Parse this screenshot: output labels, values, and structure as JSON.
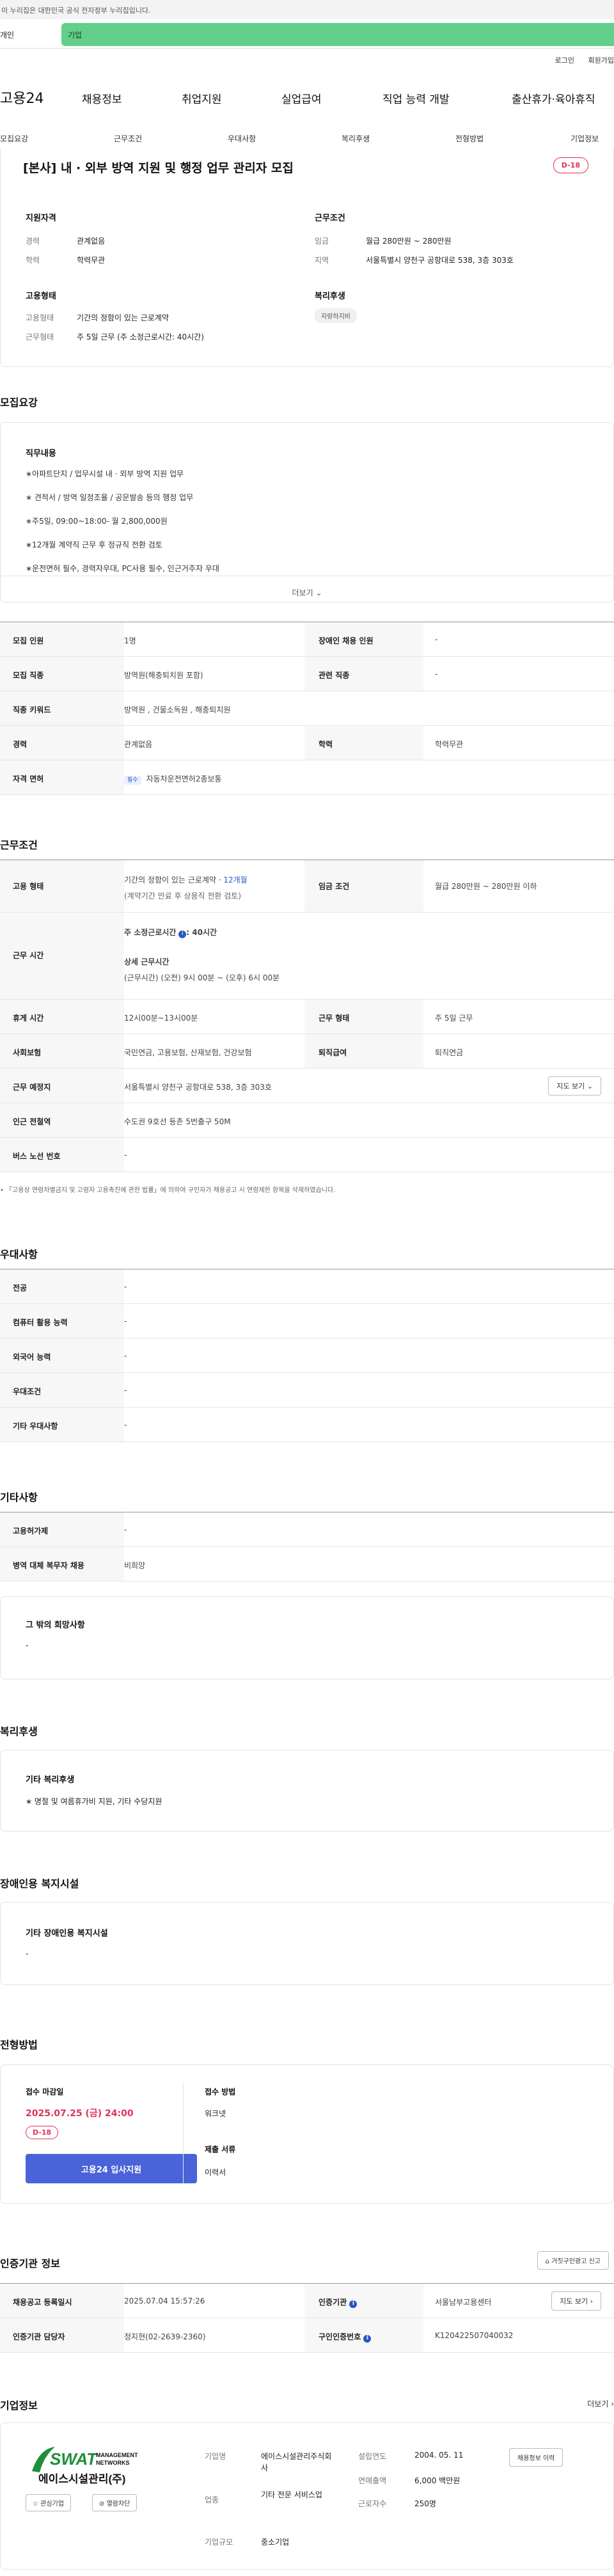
{
  "gov_banner": "이 누리집은 대한민국 공식 전자정부 누리집입니다.",
  "top_tabs": {
    "person": "개인",
    "corp": "기업"
  },
  "util": {
    "login": "로그인",
    "signup": "회원가입"
  },
  "gnb": {
    "logo": "고용24",
    "menus": [
      "채용정보",
      "취업지원",
      "실업급여",
      "직업 능력 개발",
      "출산휴가·육아휴직"
    ]
  },
  "lnb": [
    "모집요강",
    "근무조건",
    "우대사항",
    "복리후생",
    "전형방법",
    "기업정보"
  ],
  "header": {
    "title": "[본사] 내 · 외부 방역 지원 및 행정 업무 관리자 모집",
    "dday": "D-18",
    "qual_label": "지원자격",
    "career_k": "경력",
    "career_v": "관계없음",
    "edu_k": "학력",
    "edu_v": "학력무관",
    "cond_label": "근무조건",
    "wage_k": "임금",
    "wage_v": "월급 280만원 ~ 280만원",
    "area_k": "지역",
    "area_v": "서울특별시 양천구 공항대로 538, 3층 303호",
    "emp_label": "고용형태",
    "emptype_k": "고용형태",
    "emptype_v": "기간의 정함이 있는 근로계약",
    "worktype_k": "근무형태",
    "worktype_v": "주 5일 근무 (주 소정근로시간: 40시간)",
    "welfare_label": "복리후생",
    "welfare_chip": "자랑하지비"
  },
  "recruit": {
    "heading": "모집요강",
    "duty_label": "직무내용",
    "duties": [
      "∗아파트단지 / 업무시설 내 · 외부 방역 지원 업무",
      "∗ 견적서 / 방역 일정조율 / 공문발송 등의 행정 업무",
      "∗주5일, 09:00~18:00- 월 2,800,000원",
      "∗12개월 계약직 근무 후 정규직 전환 검토",
      "∗운전면허 필수, 경력자우대, PC사용 필수, 인근거주자 우대"
    ],
    "more": "더보기"
  },
  "recruit_table": {
    "headcount_k": "모집 인원",
    "headcount_v": "1명",
    "disabled_k": "장애인 채용 인원",
    "disabled_v": "-",
    "job_k": "모집 직종",
    "job_v": "방역원(해충퇴치원 포함)",
    "related_k": "관련 직종",
    "related_v": "-",
    "keyword_k": "직종 키워드",
    "keyword_v": "방역원 , 건물소독원 , 해충퇴치원",
    "career_k": "경력",
    "career_v": "관계없음",
    "edu_k": "학력",
    "edu_v": "학력무관",
    "license_k": "자격 면허",
    "license_tag": "필수",
    "license_v": "자동차운전면허2종보통"
  },
  "work": {
    "heading": "근무조건",
    "emptype_k": "고용 형태",
    "emptype_v1": "기간의 정함이 있는 근로계약 · ",
    "emptype_months": "12개월",
    "emptype_v2": "(계약기간 만료 후 상용직 전환 검토)",
    "wage_k": "임금 조건",
    "wage_v": "월급 280만원 ~ 280만원 이하",
    "hours_k": "근무 시간",
    "hours_weekly_label": "주 소정근로시간",
    "hours_weekly_v": ": 40시간",
    "hours_detail_label": "상세 근무시간",
    "hours_detail_v": "(근무시간) (오전) 9시 00분 ~ (오후) 6시 00분",
    "break_k": "휴게 시간",
    "break_v": "12시00분~13시00분",
    "form_k": "근무 형태",
    "form_v": "주 5일 근무",
    "ins_k": "사회보험",
    "ins_v": "국민연금, 고용보험, 산재보험, 건강보험",
    "retire_k": "퇴직급여",
    "retire_v": "퇴직연금",
    "place_k": "근무 예정지",
    "place_v": "서울특별시 양천구 공항대로 538, 3층 303호",
    "map_btn": "지도 보기",
    "subway_k": "인근 전철역",
    "subway_v": "수도권 9호선 등촌 5번출구 50M",
    "bus_k": "버스 노선 번호",
    "bus_v": "-",
    "note": "「고용상 연령차별금지 및 고령자 고용촉진에 관한 법률」에 의하여 구인자가 채용공고 시 연령제한 항목을 삭제하였습니다."
  },
  "pref": {
    "heading": "우대사항",
    "rows": [
      {
        "k": "전공",
        "v": "-"
      },
      {
        "k": "컴퓨터 활용 능력",
        "v": "-"
      },
      {
        "k": "외국어 능력",
        "v": "-"
      },
      {
        "k": "우대조건",
        "v": "-"
      },
      {
        "k": "기타 우대사항",
        "v": "-"
      }
    ]
  },
  "etc": {
    "heading": "기타사항",
    "rows": [
      {
        "k": "고용허가제",
        "v": "-"
      },
      {
        "k": "병역 대체 복무자 채용",
        "v": "비희망"
      }
    ],
    "hope_label": "그 밖의 희망사항",
    "hope_v": "-"
  },
  "welfare": {
    "heading": "복리후생",
    "label": "기타 복리후생",
    "v": "∗ 명절 및 여름휴가비 지원, 기타 수당지원"
  },
  "disability": {
    "heading": "장애인용 복지시설",
    "label": "기타 장애인용 복지시설",
    "v": "-"
  },
  "screening": {
    "heading": "전형방법",
    "deadline_label": "접수 마감일",
    "deadline_v": "2025.07.25 (금) 24:00",
    "dday": "D-18",
    "apply_btn": "고용24 입사지원",
    "method_label": "접수 방법",
    "method_v": "워크넷",
    "docs_label": "제출 서류",
    "docs_v": "이력서"
  },
  "agency": {
    "heading": "인증기관 정보",
    "report_btn": "거짓구인광고 신고",
    "reg_k": "채용공고 등록일시",
    "reg_v": "2025.07.04 15:57:26",
    "agency_k": "인증기관",
    "agency_v": "서울남부고용센터",
    "map_btn": "지도 보기",
    "manager_k": "인증기관 담당자",
    "manager_v": "정지현(02-2639-2360)",
    "reqno_k": "구인인증번호",
    "reqno_v": "K120422507040032"
  },
  "company": {
    "heading": "기업정보",
    "more": "더보기",
    "logo_text1": "SWAT",
    "logo_text2": "MANAGEMENT NETWORKS",
    "name": "에이스시설관리(주)",
    "fav_btn": "관심기업",
    "block_btn": "열람차단",
    "name_k": "기업명",
    "name_v": "에이스시설관리주식회사",
    "industry_k": "업종",
    "industry_v": "기타 전문 서비스업",
    "size_k": "기업규모",
    "size_v": "중소기업",
    "founded_k": "설립연도",
    "founded_v": "2004. 05. 11",
    "revenue_k": "연매출액",
    "revenue_v": "6,000 백만원",
    "staff_k": "근로자수",
    "staff_v": "250명",
    "history_btn": "채용정보 이력"
  }
}
